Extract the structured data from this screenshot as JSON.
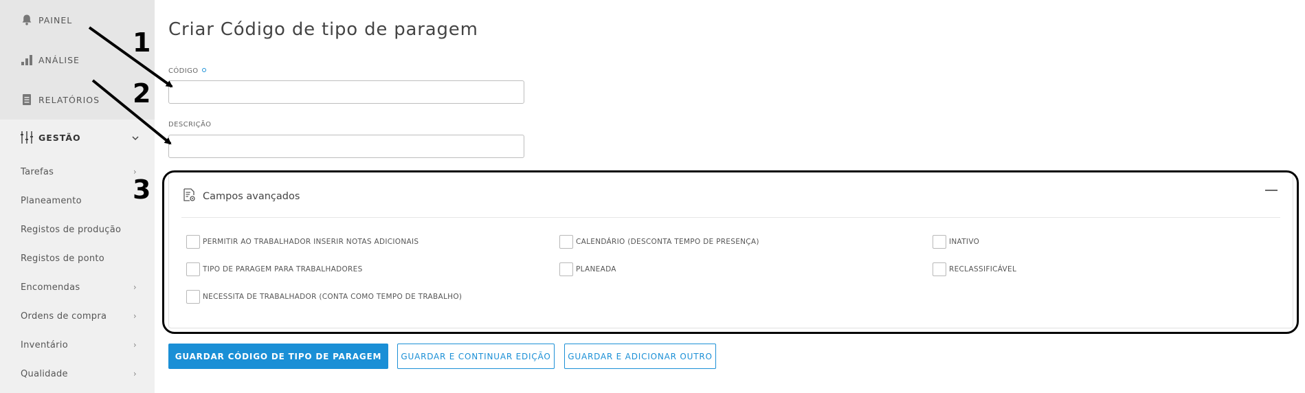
{
  "sidebar": {
    "top_items": [
      {
        "label": "PAINEL",
        "icon": "bell-icon"
      },
      {
        "label": "ANÁLISE",
        "icon": "bar-chart-icon"
      },
      {
        "label": "RELATÓRIOS",
        "icon": "report-icon"
      }
    ],
    "section": {
      "label": "GESTÃO",
      "icon": "sliders-icon"
    },
    "sub_items": [
      {
        "label": "Tarefas",
        "has_arrow": true
      },
      {
        "label": "Planeamento",
        "has_arrow": false
      },
      {
        "label": "Registos de produção",
        "has_arrow": false
      },
      {
        "label": "Registos de ponto",
        "has_arrow": false
      },
      {
        "label": "Encomendas",
        "has_arrow": true
      },
      {
        "label": "Ordens de compra",
        "has_arrow": true
      },
      {
        "label": "Inventário",
        "has_arrow": true
      },
      {
        "label": "Qualidade",
        "has_arrow": true
      }
    ]
  },
  "page": {
    "title": "Criar Código de tipo de paragem"
  },
  "form": {
    "codigo": {
      "label": "CÓDIGO",
      "value": "",
      "required": true
    },
    "descricao": {
      "label": "DESCRIÇÃO",
      "value": ""
    }
  },
  "advanced": {
    "title": "Campos avançados",
    "checkboxes": [
      "PERMITIR AO TRABALHADOR INSERIR NOTAS ADICIONAIS",
      "CALENDÁRIO (DESCONTA TEMPO DE PRESENÇA)",
      "INATIVO",
      "TIPO DE PARAGEM PARA TRABALHADORES",
      "PLANEADA",
      "RECLASSIFICÁVEL",
      "NECESSITA DE TRABALHADOR (CONTA COMO TEMPO DE TRABALHO)"
    ]
  },
  "buttons": {
    "save": "GUARDAR CÓDIGO DE TIPO DE PARAGEM",
    "save_continue": "GUARDAR E CONTINUAR EDIÇÃO",
    "save_add": "GUARDAR E ADICIONAR OUTRO"
  },
  "annotations": [
    "1",
    "2",
    "3"
  ],
  "colors": {
    "accent": "#1a8fd6",
    "sidebar_bg": "#f0f0f0",
    "sidebar_top_bg": "#e6e6e6"
  }
}
